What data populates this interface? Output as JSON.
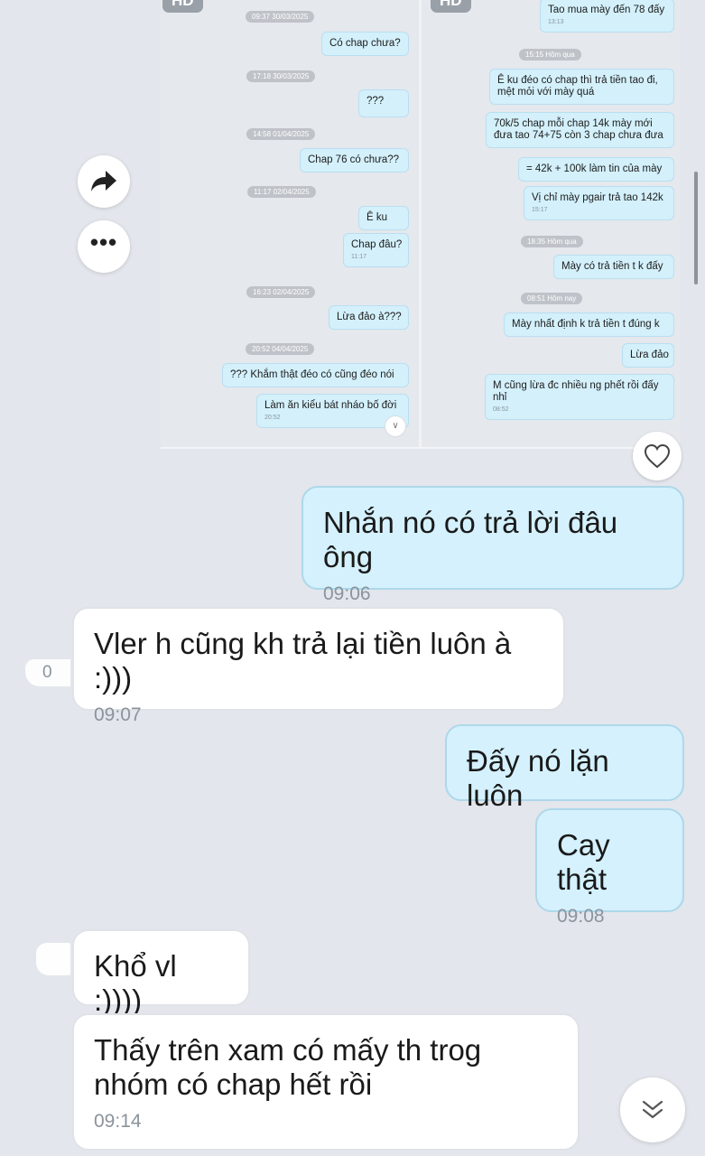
{
  "image_preview": {
    "hd_badge": "HD",
    "left_column": {
      "items": [
        {
          "kind": "ts",
          "text": "09:37 30/03/2025"
        },
        {
          "kind": "msg",
          "text": "Có chap chưa?"
        },
        {
          "kind": "ts",
          "text": "17:18 30/03/2025"
        },
        {
          "kind": "msg",
          "text": "???"
        },
        {
          "kind": "ts",
          "text": "14:58 01/04/2025"
        },
        {
          "kind": "msg",
          "text": "Chap 76 có chưa??"
        },
        {
          "kind": "ts",
          "text": "11:17 02/04/2025"
        },
        {
          "kind": "msg",
          "text": "Ê ku"
        },
        {
          "kind": "msg",
          "text": "Chap đâu?",
          "time": "11:17"
        },
        {
          "kind": "ts",
          "text": "16:23 02/04/2025"
        },
        {
          "kind": "msg",
          "text": "Lừa đảo à???"
        },
        {
          "kind": "ts",
          "text": "20:52 04/04/2025"
        },
        {
          "kind": "msg",
          "text": "??? Khắm thật đéo có cũng đéo nói"
        },
        {
          "kind": "msg",
          "text": "Làm ăn kiểu bát nháo bố đời",
          "time": "20:52"
        }
      ]
    },
    "right_column": {
      "items": [
        {
          "kind": "msg",
          "text": "Tao mua mày đến 78 đấy",
          "time": "13:13"
        },
        {
          "kind": "ts",
          "text": "15:15 Hôm qua"
        },
        {
          "kind": "msg",
          "text": "Ê ku đéo có chap thì trả tiền tao đi, mệt mỏi với mày quá"
        },
        {
          "kind": "msg",
          "text": "70k/5 chap mỗi chap 14k mày mới đưa tao 74+75 còn 3 chap chưa đưa"
        },
        {
          "kind": "msg",
          "text": "= 42k + 100k làm tin của mày"
        },
        {
          "kind": "msg",
          "text": "Vị chỉ mày pgair trả tao 142k",
          "time": "15:17"
        },
        {
          "kind": "ts",
          "text": "18:35 Hôm qua"
        },
        {
          "kind": "msg",
          "text": "Mày có trả tiền t k đấy"
        },
        {
          "kind": "ts",
          "text": "08:51 Hôm nay"
        },
        {
          "kind": "msg",
          "text": "Mày nhất định k trả tiền t đúng k"
        },
        {
          "kind": "msg",
          "text": "Lừa đảo"
        },
        {
          "kind": "msg",
          "text": "M cũng lừa đc nhiều ng phết rồi đấy nhỉ",
          "time": "08:52"
        }
      ]
    }
  },
  "icons": {
    "forward": "forward-arrow-icon",
    "more": "more-dots-icon",
    "heart": "heart-icon",
    "scroll_down": "double-chevron-down-icon"
  },
  "reactions": {
    "first_count": "0"
  },
  "messages": [
    {
      "dir": "out",
      "text": "Nhắn nó có trả lời đâu ông",
      "time": "09:06"
    },
    {
      "dir": "in",
      "text": "Vler h cũng kh trả lại tiền luôn à :)))",
      "time": "09:07"
    },
    {
      "dir": "out",
      "text": "Đấy nó lặn luôn",
      "time": ""
    },
    {
      "dir": "out",
      "text": "Cay thật",
      "time": "09:08"
    },
    {
      "dir": "in",
      "text": "Khổ vl :))))",
      "time": ""
    },
    {
      "dir": "in",
      "text": "Thấy trên xam có mấy th trog nhóm có chap hết rồi",
      "time": "09:14"
    }
  ],
  "colors": {
    "background": "#e3e6ec",
    "outgoing_bubble": "#d4f1fd",
    "incoming_bubble": "#ffffff",
    "timestamp_text": "#8b939b"
  }
}
